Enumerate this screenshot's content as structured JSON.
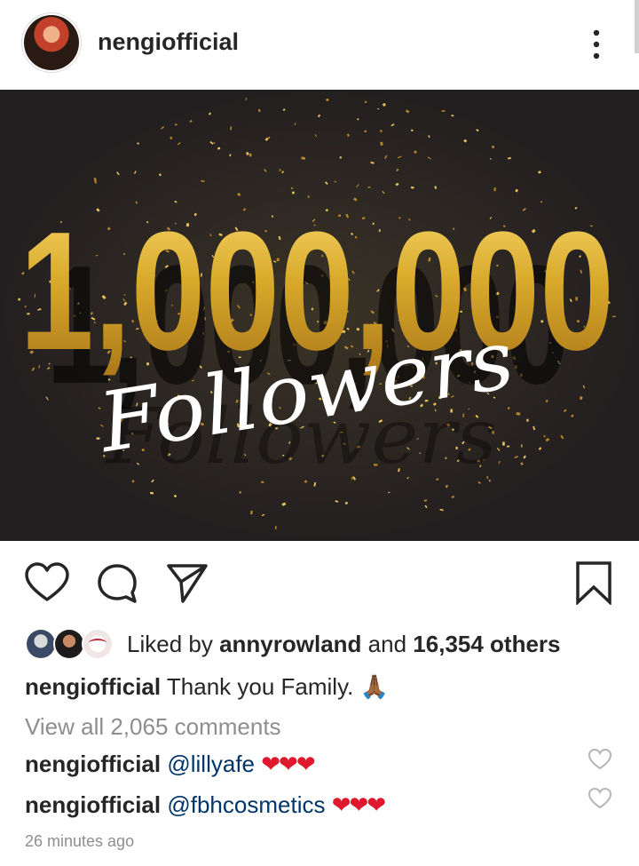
{
  "post": {
    "username": "nengiofficial",
    "image_text": {
      "number": "1,000,000",
      "word": "Followers"
    },
    "likes": {
      "prefix": "Liked by",
      "user": "annyrowland",
      "middle": "and",
      "count": "16,354 others"
    },
    "caption": {
      "username": "nengiofficial",
      "text": "Thank you Family.",
      "emoji": "🙏🏾"
    },
    "view_all": "View all 2,065 comments",
    "comments": [
      {
        "username": "nengiofficial",
        "mention": "@lillyafe",
        "hearts": "❤❤❤"
      },
      {
        "username": "nengiofficial",
        "mention": "@fbhcosmetics",
        "hearts": "❤❤❤"
      }
    ],
    "timestamp": "26 minutes ago"
  },
  "icons": {
    "like": "heart-icon",
    "comment": "comment-bubble-icon",
    "share": "paper-plane-icon",
    "save": "bookmark-icon",
    "more": "more-vertical-icon"
  },
  "colors": {
    "heart_red": "#e0182d",
    "muted_gray": "#8e8e8e",
    "text": "#262626",
    "image_bg": "#231f20",
    "gold": "#d8a92a"
  }
}
